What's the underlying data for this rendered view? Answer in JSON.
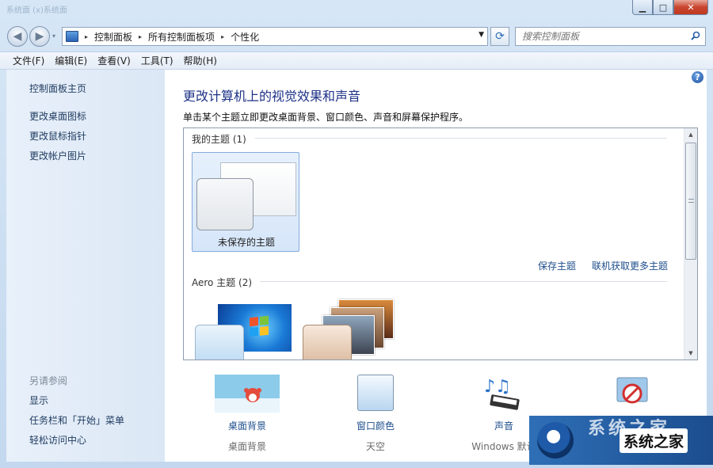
{
  "titlebar": {
    "ghost_title": "系统面 (x)系统面"
  },
  "window_controls": {
    "minimize": "▁",
    "maximize": "□",
    "close": "✕"
  },
  "navbar": {
    "back": "◀",
    "forward": "▶",
    "recent": "▾",
    "breadcrumbs": [
      "控制面板",
      "所有控制面板项",
      "个性化"
    ],
    "crumb_sep": "▸",
    "dropdown": "▼",
    "refresh": "⟳",
    "search_placeholder": "搜索控制面板"
  },
  "menubar": {
    "items": [
      "文件(F)",
      "编辑(E)",
      "查看(V)",
      "工具(T)",
      "帮助(H)"
    ]
  },
  "sidebar": {
    "home": "控制面板主页",
    "links": [
      "更改桌面图标",
      "更改鼠标指针",
      "更改帐户图片"
    ],
    "see_also_header": "另请参阅",
    "see_also": [
      "显示",
      "任务栏和「开始」菜单",
      "轻松访问中心"
    ]
  },
  "main": {
    "help": "?",
    "heading": "更改计算机上的视觉效果和声音",
    "subtitle": "单击某个主题立即更改桌面背景、窗口颜色、声音和屏幕保护程序。",
    "my_themes_label": "我的主题 (1)",
    "unsaved_theme": "未保存的主题",
    "save_theme": "保存主题",
    "get_more_themes": "联机获取更多主题",
    "aero_label": "Aero 主题 (2)"
  },
  "bottom_items": [
    {
      "name": "desktop-background",
      "label": "桌面背景",
      "sub": "桌面背景"
    },
    {
      "name": "window-color",
      "label": "窗口颜色",
      "sub": "天空"
    },
    {
      "name": "sounds",
      "label": "声音",
      "sub": "Windows 默认"
    },
    {
      "name": "screen-saver",
      "label": "",
      "sub": ""
    }
  ],
  "watermark": {
    "text": "系统之家",
    "faded": "系统之家"
  },
  "colors": {
    "link": "#1e4e8c",
    "heading": "#1e3287",
    "sidebar_bg": "#dbe7f5"
  }
}
